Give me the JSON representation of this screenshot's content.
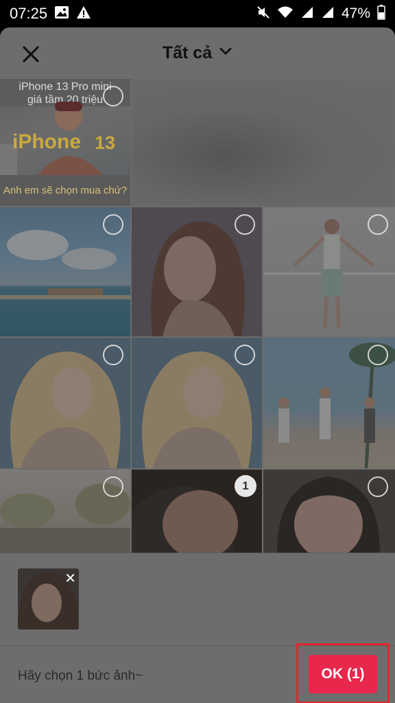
{
  "status_bar": {
    "time": "07:25",
    "battery_percent": "47%"
  },
  "header": {
    "title": "Tất cả"
  },
  "grid": {
    "promo": {
      "top_text": "iPhone 13 Pro mini\ngiá tầm 20 triệu",
      "brand_text": "iPhone",
      "model_text": "13",
      "bottom_text": "Anh em sẽ chọn mua chứ?"
    },
    "selected_number": "1"
  },
  "footer": {
    "hint": "Hãy chọn 1 bức ảnh~",
    "ok_label": "OK (1)"
  },
  "colors": {
    "ok_button": "#e8274d",
    "highlight_frame": "#e3262d",
    "overlay": "#6d6d6d"
  }
}
